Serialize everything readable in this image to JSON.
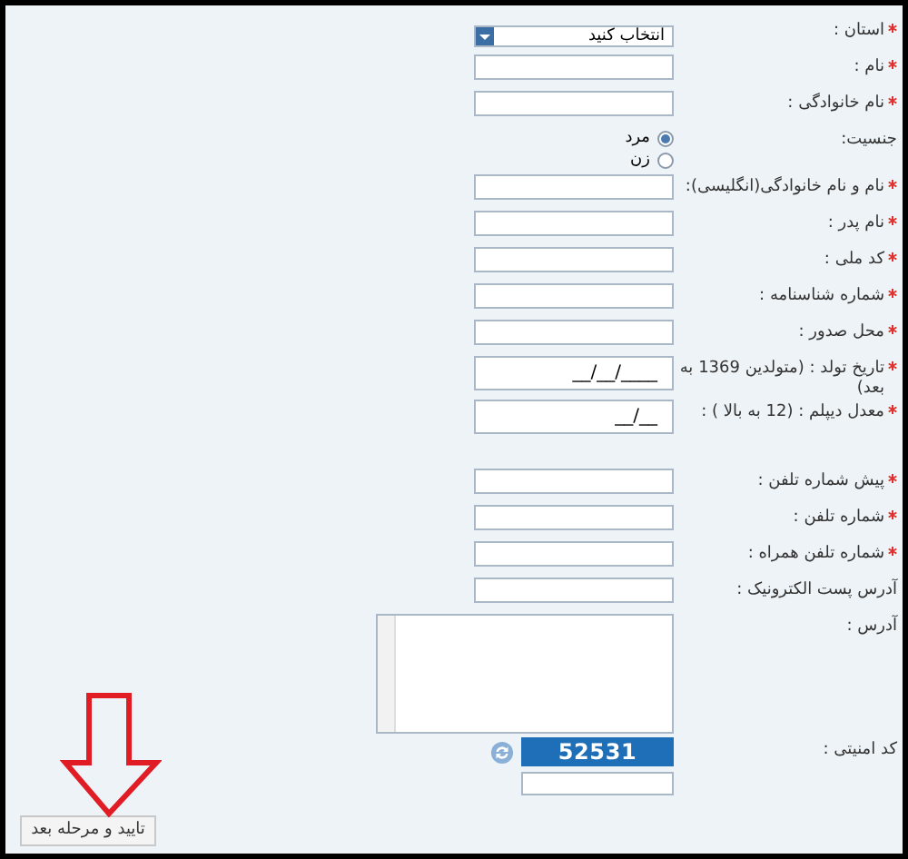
{
  "sections": [
    [
      {
        "kind": "select",
        "label": "استان :",
        "required": true,
        "value": "انتخاب کنید"
      },
      {
        "kind": "text",
        "label": "نام :",
        "required": true
      },
      {
        "kind": "text",
        "label": "نام خانوادگی :",
        "required": true
      },
      {
        "kind": "radio",
        "label": "جنسیت:",
        "required": false,
        "options": [
          {
            "label": "مرد",
            "selected": true
          },
          {
            "label": "زن",
            "selected": false
          }
        ]
      },
      {
        "kind": "text",
        "label": "نام و نام خانوادگی(انگلیسی):",
        "required": true
      },
      {
        "kind": "text",
        "label": "نام پدر :",
        "required": true
      },
      {
        "kind": "text",
        "label": "کد ملی :",
        "required": true
      },
      {
        "kind": "text",
        "label": "شماره شناسنامه :",
        "required": true
      },
      {
        "kind": "text",
        "label": "محل صدور :",
        "required": true
      },
      {
        "kind": "text",
        "label": "تاریخ تولد : (متولدین 1369 به بعد)",
        "required": true,
        "value": "__/__/____"
      },
      {
        "kind": "text",
        "label": "معدل دیپلم : (12 به بالا ) :",
        "required": true,
        "value": "__/__"
      }
    ],
    [
      {
        "kind": "text",
        "label": "پیش شماره تلفن :",
        "required": true
      },
      {
        "kind": "text",
        "label": "شماره تلفن :",
        "required": true
      },
      {
        "kind": "text",
        "label": "شماره تلفن همراه :",
        "required": true
      },
      {
        "kind": "text",
        "label": "آدرس پست الکترونیک :",
        "required": false
      },
      {
        "kind": "textarea",
        "label": "آدرس :",
        "required": false
      },
      {
        "kind": "captcha",
        "label": "کد امنیتی :",
        "required": false,
        "code": "52531"
      }
    ]
  ],
  "submit": "تایید و مرحله بعد"
}
